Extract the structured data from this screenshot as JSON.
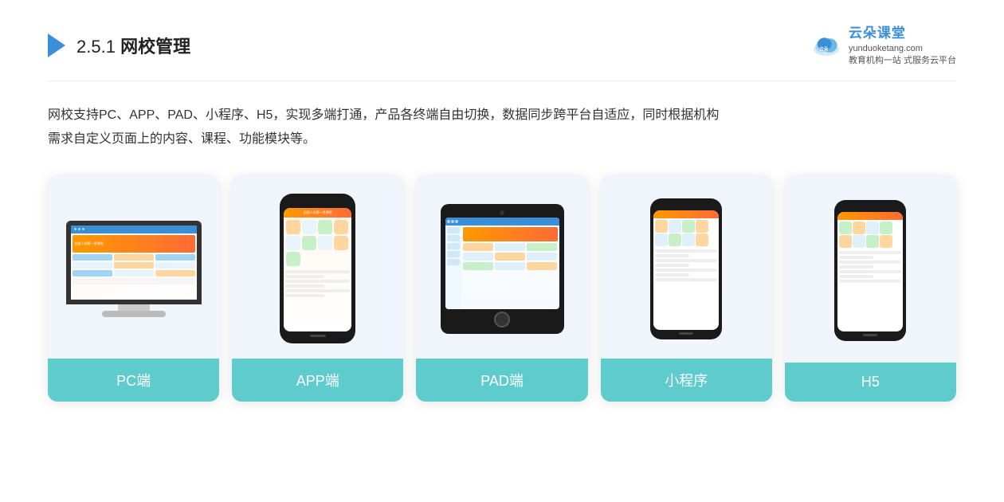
{
  "header": {
    "section_number": "2.5.1",
    "title_plain": " ",
    "title_bold": "网校管理",
    "logo_url": "",
    "brand_name": "云朵课堂",
    "brand_site": "yunduoketang.com",
    "brand_tagline": "教育机构一站\n式服务云平台"
  },
  "description": {
    "text_line1": "网校支持PC、APP、PAD、小程序、H5，实现多端打通，产品各终端自由切换，数据同步跨平台自适应，同时根据机构",
    "text_line2": "需求自定义页面上的内容、课程、功能模块等。"
  },
  "cards": [
    {
      "id": "pc",
      "label": "PC端"
    },
    {
      "id": "app",
      "label": "APP端"
    },
    {
      "id": "pad",
      "label": "PAD端"
    },
    {
      "id": "miniapp",
      "label": "小程序"
    },
    {
      "id": "h5",
      "label": "H5"
    }
  ],
  "accent_color": "#5ecbcc"
}
